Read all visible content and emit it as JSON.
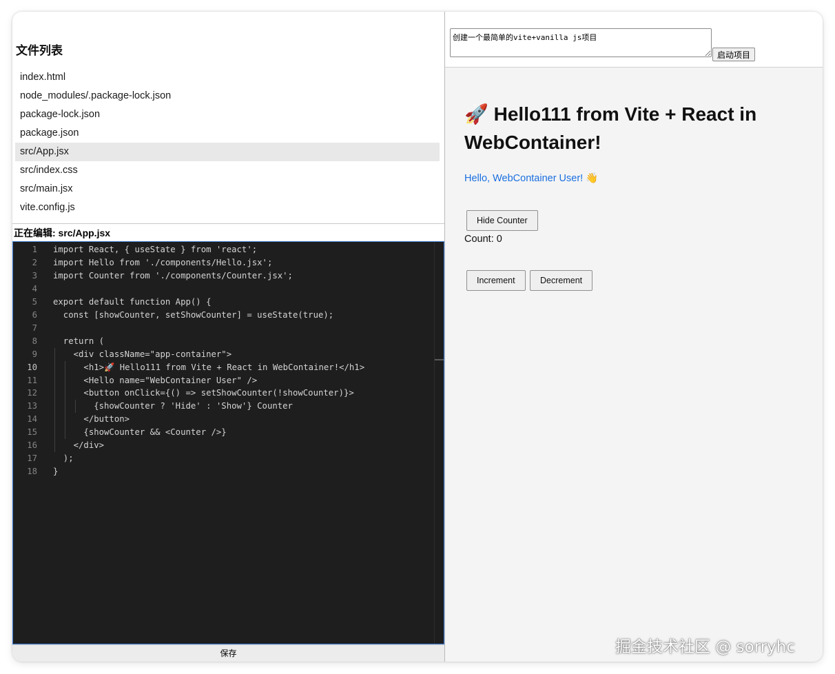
{
  "file_list": {
    "title": "文件列表",
    "items": [
      {
        "label": "index.html"
      },
      {
        "label": "node_modules/.package-lock.json"
      },
      {
        "label": "package-lock.json"
      },
      {
        "label": "package.json"
      },
      {
        "label": "src/App.jsx",
        "active": true
      },
      {
        "label": "src/index.css"
      },
      {
        "label": "src/main.jsx"
      },
      {
        "label": "vite.config.js"
      }
    ]
  },
  "editor": {
    "editing_label": "正在编辑: src/App.jsx",
    "current_line": 10,
    "lines": [
      {
        "n": "1",
        "text": "import React, { useState } from 'react';"
      },
      {
        "n": "2",
        "text": "import Hello from './components/Hello.jsx';"
      },
      {
        "n": "3",
        "text": "import Counter from './components/Counter.jsx';"
      },
      {
        "n": "4",
        "text": ""
      },
      {
        "n": "5",
        "text": "export default function App() {"
      },
      {
        "n": "6",
        "text": "  const [showCounter, setShowCounter] = useState(true);"
      },
      {
        "n": "7",
        "text": ""
      },
      {
        "n": "8",
        "text": "  return ("
      },
      {
        "n": "9",
        "text": "    <div className=\"app-container\">"
      },
      {
        "n": "10",
        "text": "      <h1>🚀 Hello111 from Vite + React in WebContainer!</h1>"
      },
      {
        "n": "11",
        "text": "      <Hello name=\"WebContainer User\" />"
      },
      {
        "n": "12",
        "text": "      <button onClick={() => setShowCounter(!showCounter)}>"
      },
      {
        "n": "13",
        "text": "        {showCounter ? 'Hide' : 'Show'} Counter"
      },
      {
        "n": "14",
        "text": "      </button>"
      },
      {
        "n": "15",
        "text": "      {showCounter && <Counter />}"
      },
      {
        "n": "16",
        "text": "    </div>"
      },
      {
        "n": "17",
        "text": "  );"
      },
      {
        "n": "18",
        "text": "}"
      }
    ],
    "save_label": "保存"
  },
  "prompt": {
    "value": "创建一个最简单的vite+vanilla js项目",
    "launch_label": "启动项目"
  },
  "preview": {
    "heading": "🚀 Hello111 from Vite + React in WebContainer!",
    "hello": "Hello, WebContainer User! 👋",
    "toggle_label": "Hide Counter",
    "count": "Count: 0",
    "increment_label": "Increment",
    "decrement_label": "Decrement"
  },
  "watermark": "掘金技术社区 @ sorryhc",
  "colors": {
    "editor_bg": "#1e1e1e",
    "editor_text": "#d4d4d4",
    "link_blue": "#1a6fe0",
    "active_file_bg": "#e8e8e8"
  }
}
